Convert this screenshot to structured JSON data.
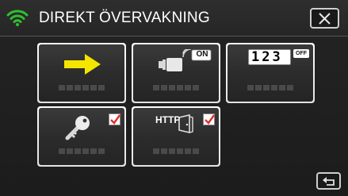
{
  "header": {
    "title": "DIREKT ÖVERVAKNING",
    "wifi_icon": "wifi-icon",
    "close_icon": "close-icon"
  },
  "tiles": [
    {
      "name": "arrow",
      "icon": "arrow-right-icon"
    },
    {
      "name": "camera-on",
      "icon": "video-camera-icon",
      "badge": "ON"
    },
    {
      "name": "counter",
      "icon": "counter-icon",
      "digits": "123",
      "badge": "OFF"
    },
    {
      "name": "key",
      "icon": "key-icon",
      "checked": true
    },
    {
      "name": "http",
      "icon": "http-door-icon",
      "text": "HTTP",
      "checked": true
    }
  ],
  "footer": {
    "back_icon": "back-return-icon"
  },
  "colors": {
    "arrow_yellow": "#f5e600",
    "check_red": "#e0302a",
    "wifi_green": "#2fc02f"
  }
}
